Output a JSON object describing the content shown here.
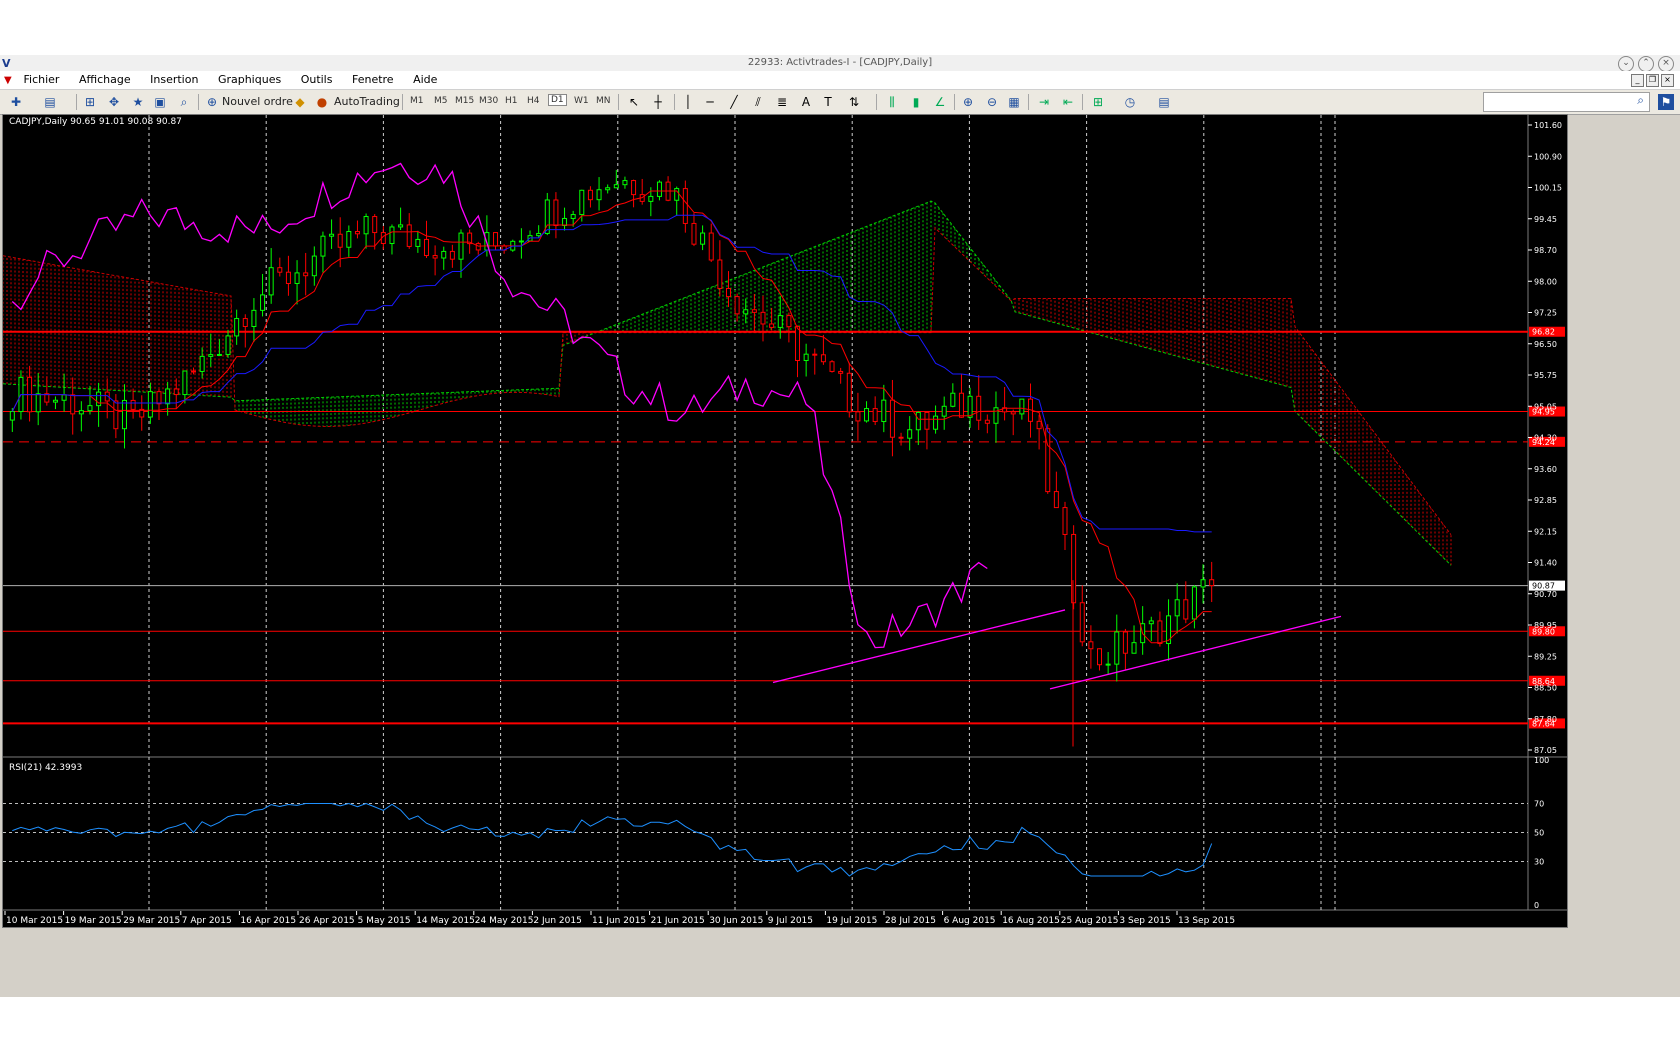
{
  "window": {
    "title": "22933: Activtrades-I - [CADJPY,Daily]"
  },
  "menu": [
    "Fichier",
    "Affichage",
    "Insertion",
    "Graphiques",
    "Outils",
    "Fenetre",
    "Aide"
  ],
  "toolbar": {
    "new_order": "Nouvel ordre",
    "autotrading": "AutoTrading",
    "timeframes": [
      "M1",
      "M5",
      "M15",
      "M30",
      "H1",
      "H4",
      "D1",
      "W1",
      "MN"
    ],
    "active_timeframe": "D1",
    "search_value": ""
  },
  "main_chart": {
    "header": "CADJPY,Daily  90.65 91.01 90.08 90.87",
    "current_price": "90.87",
    "price_axis": [
      "101.60",
      "100.90",
      "100.15",
      "99.45",
      "98.70",
      "98.00",
      "97.25",
      "96.50",
      "95.75",
      "95.05",
      "94.30",
      "93.60",
      "92.85",
      "92.15",
      "91.40",
      "90.70",
      "89.95",
      "89.25",
      "88.50",
      "87.80",
      "87.05"
    ],
    "level_tags": [
      {
        "label": "96.82",
        "price": 96.82,
        "style": "solid",
        "width": 2
      },
      {
        "label": "94.95",
        "price": 94.95,
        "style": "solid",
        "width": 1
      },
      {
        "label": "94.24",
        "price": 94.24,
        "style": "dashed",
        "width": 1
      },
      {
        "label": "89.80",
        "price": 89.8,
        "style": "solid",
        "width": 1
      },
      {
        "label": "88.64",
        "price": 88.64,
        "style": "solid",
        "width": 1
      },
      {
        "label": "87.64",
        "price": 87.64,
        "style": "solid",
        "width": 2
      }
    ],
    "grid": "dashed-vertical",
    "colors": {
      "bull": "#00ff00",
      "bear": "#ff0000",
      "tenkan": "#ff0000",
      "kijun": "#1a1aff",
      "chikou": "#ff00ff",
      "senkou_a": "#00cc00",
      "senkou_b": "#cc0000",
      "level": "#ff0000"
    }
  },
  "rsi_panel": {
    "header": "RSI(21) 42.3993",
    "axis": [
      "100",
      "70",
      "50",
      "30",
      "0"
    ],
    "color": "#1e90ff"
  },
  "time_axis": [
    "10 Mar 2015",
    "19 Mar 2015",
    "29 Mar 2015",
    "7 Apr 2015",
    "16 Apr 2015",
    "26 Apr 2015",
    "5 May 2015",
    "14 May 2015",
    "24 May 2015",
    "2 Jun 2015",
    "11 Jun 2015",
    "21 Jun 2015",
    "30 Jun 2015",
    "9 Jul 2015",
    "19 Jul 2015",
    "28 Jul 2015",
    "6 Aug 2015",
    "16 Aug 2015",
    "25 Aug 2015",
    "3 Sep 2015",
    "13 Sep 2015"
  ],
  "chart_data": {
    "type": "candlestick",
    "symbol": "CADJPY",
    "timeframe": "Daily",
    "ylim": [
      86.9,
      101.9
    ],
    "ohlc_last": {
      "open": 90.65,
      "high": 91.01,
      "low": 90.08,
      "close": 90.87
    },
    "close_path": [
      {
        "date": "10 Mar 2015",
        "close": 95.4
      },
      {
        "date": "19 Mar 2015",
        "close": 95.2
      },
      {
        "date": "29 Mar 2015",
        "close": 94.7
      },
      {
        "date": "7 Apr 2015",
        "close": 95.8
      },
      {
        "date": "16 Apr 2015",
        "close": 97.6
      },
      {
        "date": "26 Apr 2015",
        "close": 98.5
      },
      {
        "date": "5 May 2015",
        "close": 99.2
      },
      {
        "date": "14 May 2015",
        "close": 98.9
      },
      {
        "date": "24 May 2015",
        "close": 98.8
      },
      {
        "date": "2 Jun 2015",
        "close": 99.7
      },
      {
        "date": "11 Jun 2015",
        "close": 100.4
      },
      {
        "date": "21 Jun 2015",
        "close": 100.2
      },
      {
        "date": "30 Jun 2015",
        "close": 97.7
      },
      {
        "date": "9 Jul 2015",
        "close": 96.6
      },
      {
        "date": "19 Jul 2015",
        "close": 95.2
      },
      {
        "date": "28 Jul 2015",
        "close": 94.5
      },
      {
        "date": "6 Aug 2015",
        "close": 95.2
      },
      {
        "date": "16 Aug 2015",
        "close": 94.8
      },
      {
        "date": "25 Aug 2015",
        "close": 89.1
      },
      {
        "date": "3 Sep 2015",
        "close": 89.8
      },
      {
        "date": "13 Sep 2015",
        "close": 90.87
      }
    ],
    "rsi": {
      "period": 21,
      "last": 42.3993,
      "levels": [
        70,
        50,
        30
      ],
      "ylim": [
        0,
        100
      ]
    }
  }
}
